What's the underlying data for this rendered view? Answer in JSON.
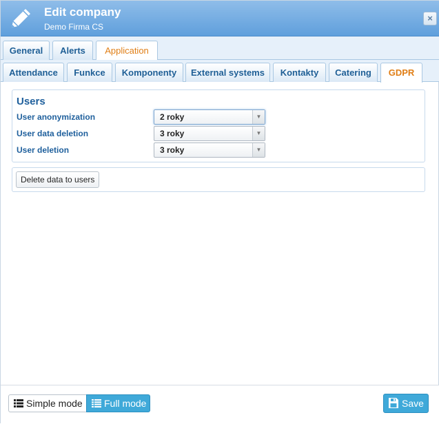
{
  "header": {
    "title": "Edit company",
    "subtitle": "Demo Firma CS",
    "icon": "pencil-icon",
    "close_icon": "close-icon"
  },
  "tabs_primary": [
    {
      "label": "General",
      "active": false
    },
    {
      "label": "Alerts",
      "active": false
    },
    {
      "label": "Application",
      "active": true
    }
  ],
  "tabs_secondary": [
    {
      "label": "Attendance",
      "active": false
    },
    {
      "label": "Funkce",
      "active": false
    },
    {
      "label": "Komponenty",
      "active": false
    },
    {
      "label": "External systems",
      "active": false
    },
    {
      "label": "Kontakty",
      "active": false
    },
    {
      "label": "Catering",
      "active": false
    },
    {
      "label": "GDPR",
      "active": true
    }
  ],
  "users": {
    "legend": "Users",
    "rows": [
      {
        "label": "User anonymization",
        "value": "2 roky"
      },
      {
        "label": "User data deletion",
        "value": "3 roky"
      },
      {
        "label": "User deletion",
        "value": "3 roky"
      }
    ]
  },
  "actions": {
    "delete_data_label": "Delete data to users"
  },
  "footer": {
    "simple_mode_label": "Simple mode",
    "full_mode_label": "Full mode",
    "save_label": "Save",
    "simple_mode_icon": "list-icon",
    "full_mode_icon": "list-icon",
    "save_icon": "floppy-disk-icon"
  },
  "colors": {
    "header_blue": "#6aa6de",
    "active_tab_orange": "#e07e15",
    "label_blue": "#1e5f9c",
    "accent_button": "#3fa9d9"
  }
}
